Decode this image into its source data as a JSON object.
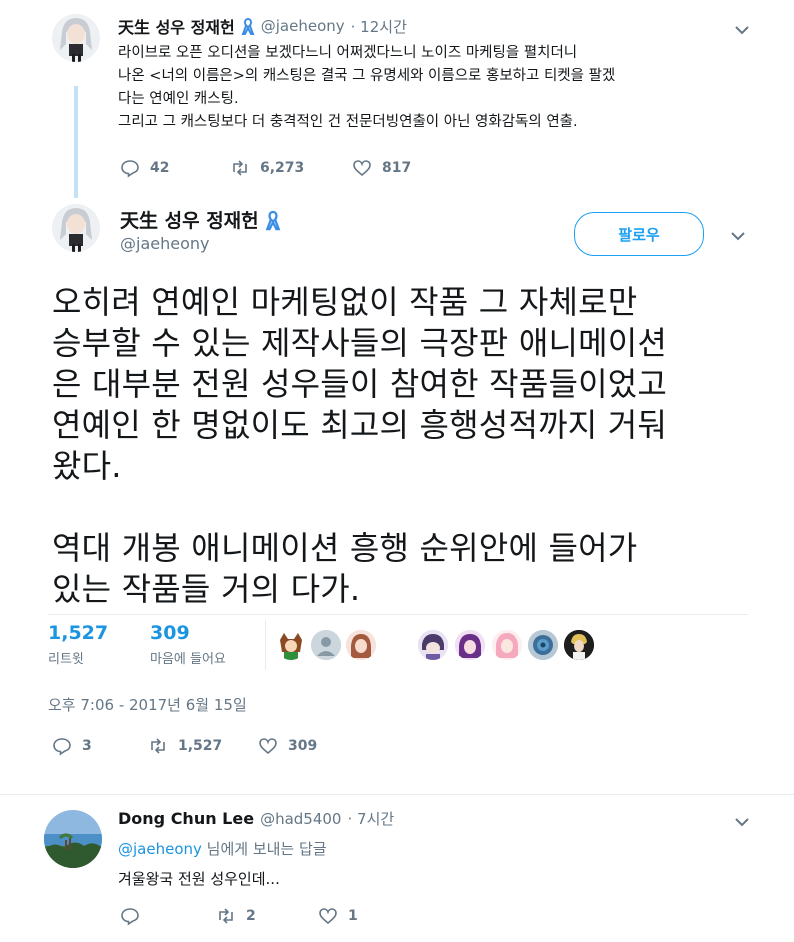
{
  "colors": {
    "accent": "#1da1f2",
    "link": "#1b95e0",
    "muted": "#657786",
    "thread_line": "#c4e1f5"
  },
  "tweet1": {
    "name": "天生 성우 정재헌",
    "ribbon_icon": "ribbon-icon",
    "handle": "@jaeheony",
    "time": "· 12시간",
    "text": "라이브로 오픈 오디션을 보겠다느니 어쩌겠다느니 노이즈 마케팅을 펼치더니\n나온 <너의 이름은>의 캐스팅은 결국 그 유명세와 이름으로 홍보하고 티켓을 팔겠\n다는 연예인 캐스팅.\n그리고 그 캐스팅보다 더 충격적인 건 전문더빙연출이 아닌 영화감독의 연출.",
    "replies": "42",
    "retweets": "6,273",
    "likes": "817"
  },
  "main_tweet": {
    "name": "天生 성우 정재헌",
    "handle": "@jaeheony",
    "follow_label": "팔로우",
    "text": "오히려 연예인 마케팅없이 작품 그 자체로만\n승부할 수 있는 제작사들의 극장판 애니메이션\n은 대부분 전원 성우들이 참여한 작품들이었고\n연예인 한 명없이도 최고의 흥행성적까지 거둬\n왔다.\n\n역대 개봉 애니메이션 흥행 순위안에 들어가\n있는 작품들 거의 다가.",
    "retweet_count": "1,527",
    "retweet_label": "리트윗",
    "like_count": "309",
    "like_label": "마음에 들어요",
    "timestamp": "오후 7:06 - 2017년 6월 15일",
    "replies": "3",
    "retweets": "1,527",
    "likes": "309"
  },
  "reply": {
    "name": "Dong Chun Lee",
    "handle": "@had5400",
    "time": "· 7시간",
    "mention": "@jaeheony",
    "replying_suffix": " 님에게 보내는 답글",
    "text": "겨울왕국 전원 성우인데...",
    "replies": "",
    "retweets": "2",
    "likes": "1"
  }
}
